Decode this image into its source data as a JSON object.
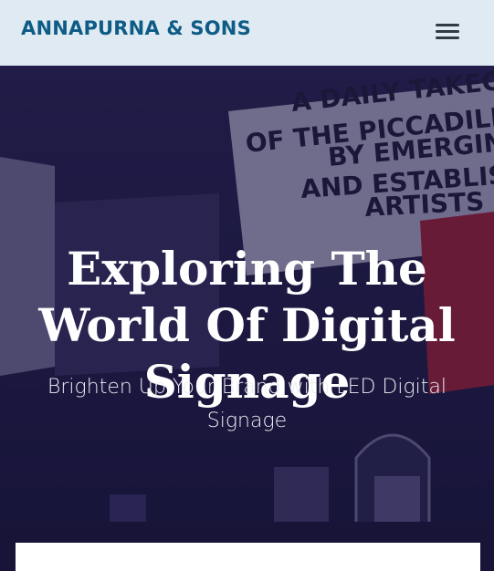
{
  "header": {
    "brand": "ANNAPURNA & SONS",
    "menu_icon": "hamburger-menu-icon"
  },
  "hero": {
    "title": "Exploring The World Of Digital Signage",
    "subtitle": "Brighten Up Your Brand with LED Digital Signage",
    "background_signage_text": "A DAILY TAKEOVER OF THE PICCADILLY LIGHTS BY EMERGING AND ESTABLISHED ARTISTS"
  },
  "colors": {
    "header_bg": "#dfeaf2",
    "brand": "#0e5c86",
    "hero_overlay": "#1d1a44",
    "accent_red": "#c8232c"
  }
}
